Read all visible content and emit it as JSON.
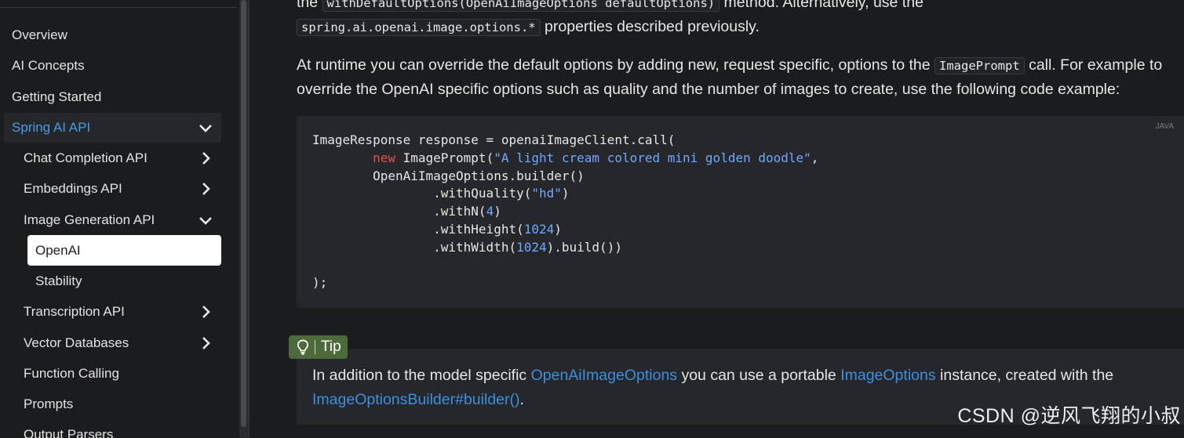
{
  "sidebar": {
    "items": [
      {
        "label": "Overview"
      },
      {
        "label": "AI Concepts"
      },
      {
        "label": "Getting Started"
      },
      {
        "label": "Spring AI API"
      },
      {
        "label": "Chat Completion API"
      },
      {
        "label": "Embeddings API"
      },
      {
        "label": "Image Generation API"
      },
      {
        "label": "OpenAI"
      },
      {
        "label": "Stability"
      },
      {
        "label": "Transcription API"
      },
      {
        "label": "Vector Databases"
      },
      {
        "label": "Function Calling"
      },
      {
        "label": "Prompts"
      },
      {
        "label": "Output Parsers"
      }
    ]
  },
  "main": {
    "p1": {
      "t1": "the ",
      "c1": "withDefaultOptions(OpenAiImageOptions defaultOptions)",
      "t2": " method. Alternatively, use the",
      "c2": "spring.ai.openai.image.options.*",
      "t3": " properties described previously."
    },
    "p2": {
      "t1": "At runtime you can override the default options by adding new, request specific, options to the ",
      "c1": "ImagePrompt",
      "t2": " call. For example to",
      "line2": "override the OpenAI specific options such as quality and the number of images to create, use the following code example:"
    },
    "code": {
      "lang": "JAVA",
      "l1": "ImageResponse response = openaiImageClient.call(",
      "l2_indent": "        ",
      "l2_kw": "new",
      "l2_a": " ImagePrompt(",
      "l2_str": "\"A light cream colored mini golden doodle\"",
      "l2_b": ",",
      "l3": "        OpenAiImageOptions.builder()",
      "l4_a": "                .withQuality(",
      "l4_str": "\"hd\"",
      "l4_b": ")",
      "l5_a": "                .withN(",
      "l5_num": "4",
      "l5_b": ")",
      "l6_a": "                .withHeight(",
      "l6_num": "1024",
      "l6_b": ")",
      "l7_a": "                .withWidth(",
      "l7_num": "1024",
      "l7_b": ").build())",
      "l8": "",
      "l9": ");"
    },
    "tip": {
      "badge": "Tip",
      "t1": "In addition to the model specific ",
      "link1": "OpenAiImageOptions",
      "t2": " you can use a portable ",
      "link2": "ImageOptions",
      "t3": " instance, created with the",
      "link3": "ImageOptionsBuilder#builder()",
      "t4": "."
    }
  },
  "watermark": "CSDN @逆风飞翔的小叔",
  "colors": {
    "accent": "#4a9ae8",
    "link": "#3d8fe0",
    "tip": "#4d6b3a",
    "keyword": "#e05252"
  }
}
